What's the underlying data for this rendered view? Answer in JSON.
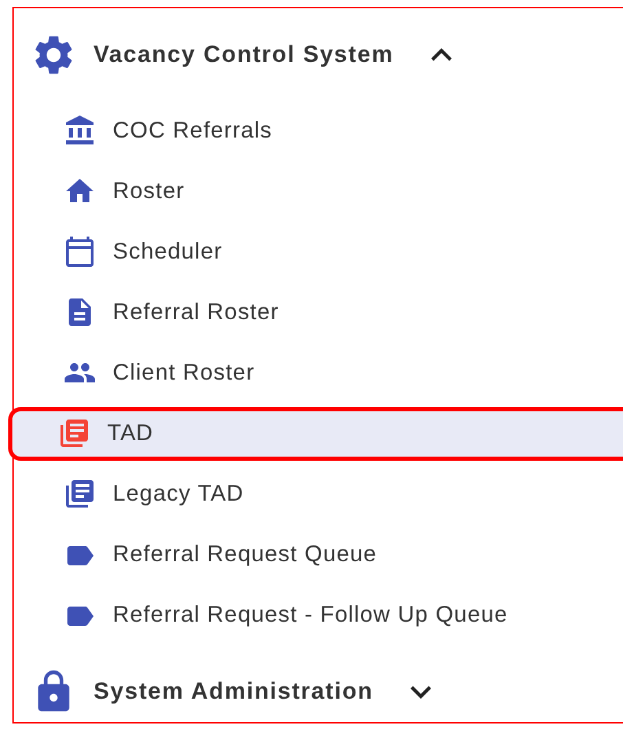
{
  "sections": [
    {
      "kind": "settings",
      "title": "Vacancy Control System",
      "expanded": true,
      "items": [
        {
          "kind": "institution",
          "label": "COC Referrals",
          "selected": false
        },
        {
          "kind": "home",
          "label": "Roster",
          "selected": false
        },
        {
          "kind": "calendar",
          "label": "Scheduler",
          "selected": false
        },
        {
          "kind": "document",
          "label": "Referral Roster",
          "selected": false
        },
        {
          "kind": "people",
          "label": "Client Roster",
          "selected": false
        },
        {
          "kind": "library",
          "label": "TAD",
          "selected": true
        },
        {
          "kind": "library",
          "label": "Legacy TAD",
          "selected": false
        },
        {
          "kind": "label",
          "label": "Referral Request Queue",
          "selected": false
        },
        {
          "kind": "label",
          "label": "Referral Request - Follow Up Queue",
          "selected": false
        }
      ]
    },
    {
      "kind": "lock",
      "title": "System Administration",
      "expanded": false
    }
  ]
}
